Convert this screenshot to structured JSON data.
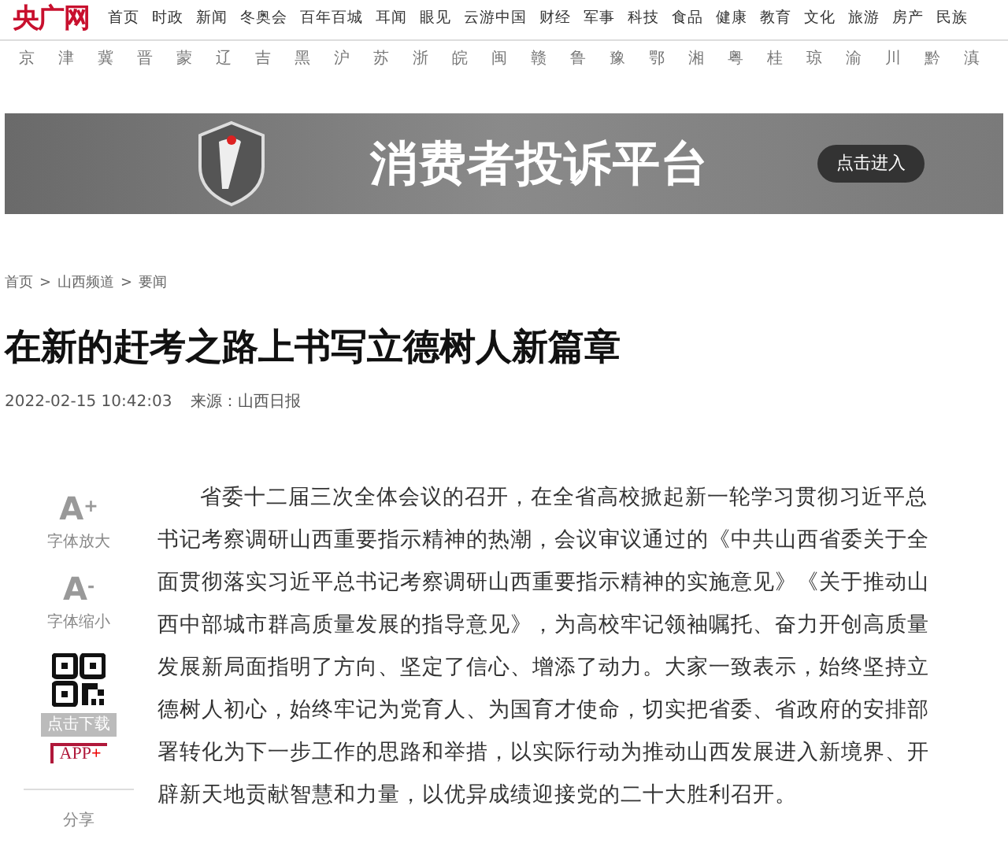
{
  "logo": "央广网",
  "nav": [
    "首页",
    "时政",
    "新闻",
    "冬奥会",
    "百年百城",
    "耳闻",
    "眼见",
    "云游中国",
    "财经",
    "军事",
    "科技",
    "食品",
    "健康",
    "教育",
    "文化",
    "旅游",
    "房产",
    "民族"
  ],
  "provinces": [
    "京",
    "津",
    "冀",
    "晋",
    "蒙",
    "辽",
    "吉",
    "黑",
    "沪",
    "苏",
    "浙",
    "皖",
    "闽",
    "赣",
    "鲁",
    "豫",
    "鄂",
    "湘",
    "粤",
    "桂",
    "琼",
    "渝",
    "川",
    "黔",
    "滇"
  ],
  "banner": {
    "title": "消费者投诉平台",
    "button": "点击进入"
  },
  "breadcrumb": [
    "首页",
    "山西频道",
    "要闻"
  ],
  "breadcrumb_separator": ">",
  "article": {
    "title": "在新的赶考之路上书写立德树人新篇章",
    "date": "2022-02-15 10:42:03",
    "source": "来源：山西日报",
    "paragraphs": [
      "省委十二届三次全体会议的召开，在全省高校掀起新一轮学习贯彻习近平总书记考察调研山西重要指示精神的热潮，会议审议通过的《中共山西省委关于全面贯彻落实习近平总书记考察调研山西重要指示精神的实施意见》《关于推动山西中部城市群高质量发展的指导意见》，为高校牢记领袖嘱托、奋力开创高质量发展新局面指明了方向、坚定了信心、增添了动力。大家一致表示，始终坚持立德树人初心，始终牢记为党育人、为国育才使命，切实把省委、省政府的安排部署转化为下一步工作的思路和举措，以实际行动为推动山西发展进入新境界、开辟新天地贡献智慧和力量，以优异成绩迎接党的二十大胜利召开。"
    ]
  },
  "tools": [
    {
      "kind": "font",
      "icon": "A",
      "sign": "+",
      "label": "字体放大"
    },
    {
      "kind": "font",
      "icon": "A",
      "sign": "-",
      "label": "字体缩小"
    },
    {
      "kind": "app",
      "label": "点击下载",
      "badge": "APP",
      "badge_mark": "+"
    },
    {
      "kind": "share",
      "label": "分享"
    }
  ]
}
